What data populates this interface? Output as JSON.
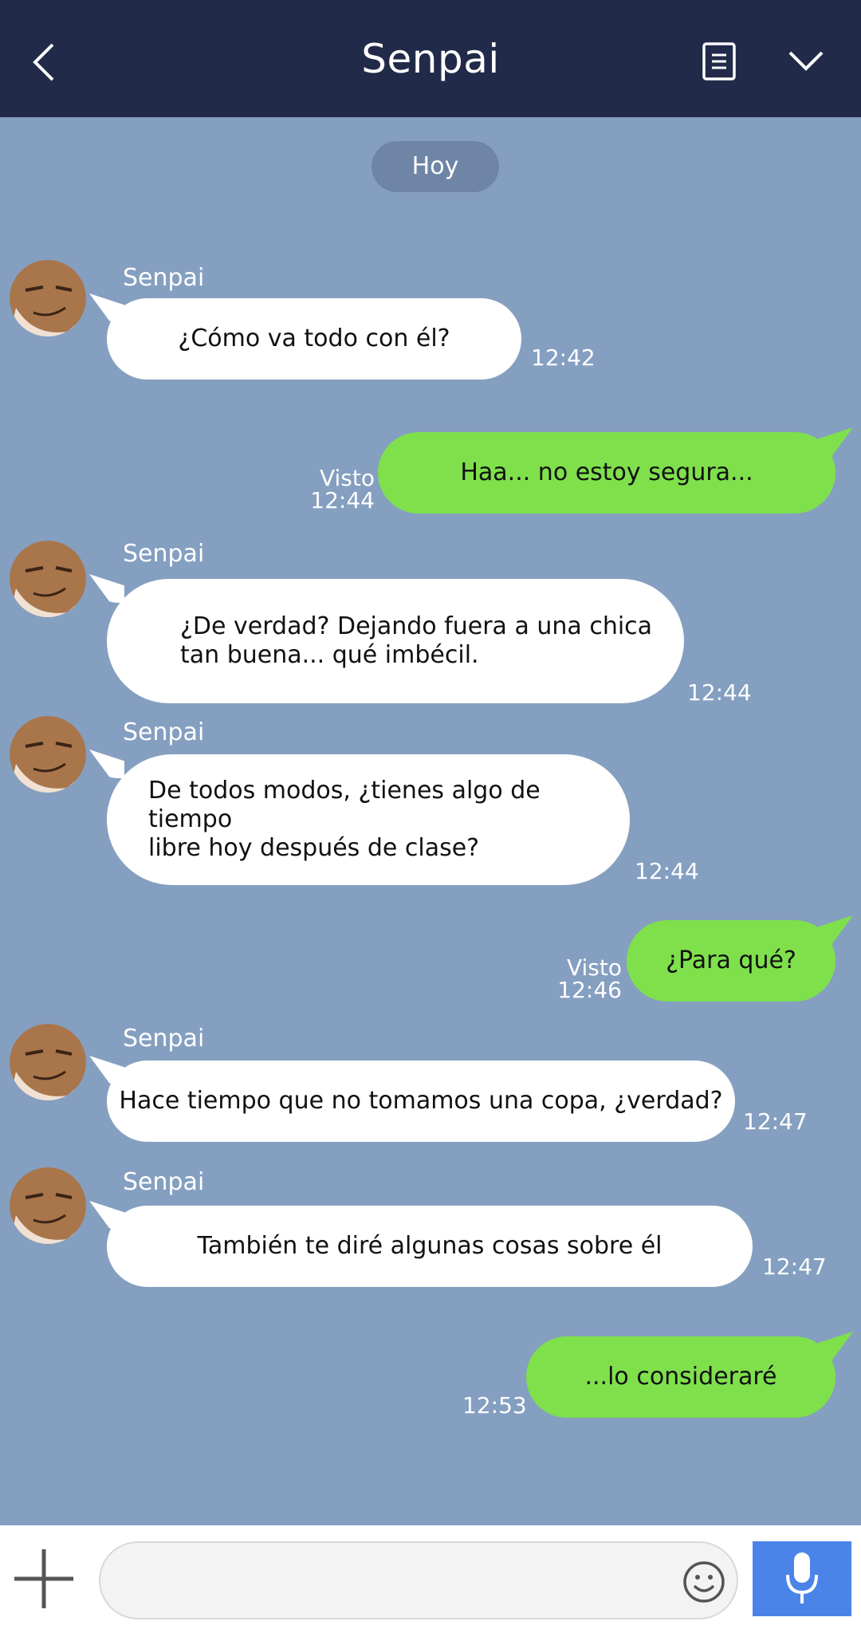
{
  "header": {
    "title": "Senpai",
    "back_icon": "chevron-left-icon",
    "notes_icon": "notes-icon",
    "menu_icon": "chevron-down-icon"
  },
  "date_label": "Hoy",
  "messages": [
    {
      "sender": "Senpai",
      "text": "¿Cómo va todo con él?",
      "time": "12:42"
    },
    {
      "text": "Haa... no estoy segura...",
      "seen": "Visto",
      "time": "12:44"
    },
    {
      "sender": "Senpai",
      "text1": "¿De verdad? Dejando fuera a una chica",
      "text2": "tan buena... qué imbécil.",
      "time": "12:44"
    },
    {
      "sender": "Senpai",
      "text1": "De todos modos, ¿tienes algo de tiempo",
      "text2": "libre hoy después de clase?",
      "time": "12:44"
    },
    {
      "text": "¿Para qué?",
      "seen": "Visto",
      "time": "12:46"
    },
    {
      "sender": "Senpai",
      "text": "Hace tiempo que no tomamos una copa, ¿verdad?",
      "time": "12:47"
    },
    {
      "sender": "Senpai",
      "text": "También te diré algunas cosas sobre él",
      "time": "12:47"
    },
    {
      "text": "...lo consideraré",
      "time": "12:53"
    }
  ],
  "input": {
    "placeholder": "",
    "emoji_icon": "smiley-icon",
    "add_icon": "plus-icon",
    "mic_icon": "microphone-icon"
  },
  "colors": {
    "header": "#212a48",
    "background": "#859fc0",
    "outgoing": "#7fe04c",
    "incoming": "#ffffff",
    "mic": "#4a84e8"
  }
}
